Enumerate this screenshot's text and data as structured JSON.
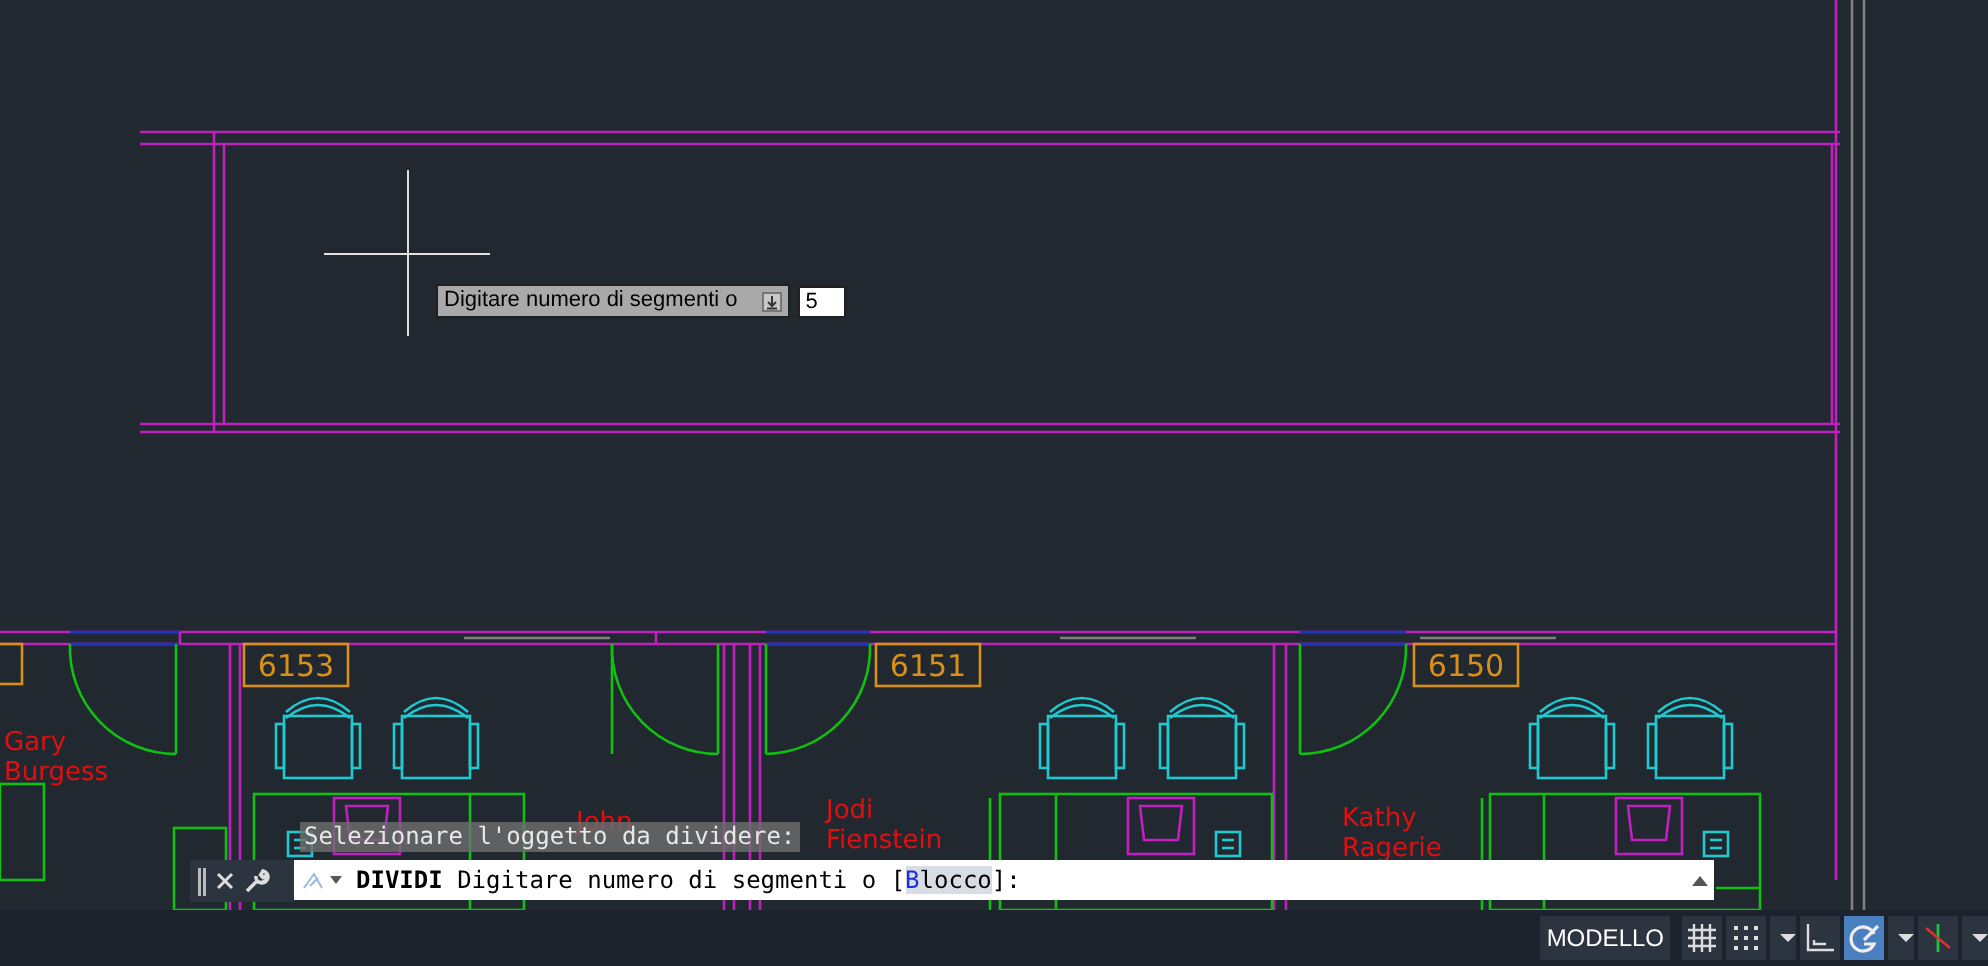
{
  "drawing": {
    "room_tags": [
      {
        "number": "6153"
      },
      {
        "number": "6151"
      },
      {
        "number": "6150"
      }
    ],
    "occupants": [
      {
        "lines": [
          "Gary",
          "Burgess"
        ]
      },
      {
        "lines": [
          "John"
        ]
      },
      {
        "lines": [
          "Jodi",
          "Fienstein"
        ]
      },
      {
        "lines": [
          "Kathy",
          "Ragerie"
        ]
      }
    ]
  },
  "dynamic_input": {
    "prompt": "Digitare numero di segmenti o",
    "value": "5"
  },
  "command_line": {
    "history": "Selezionare l'oggetto da dividere:",
    "command": "DIVIDI",
    "prompt_before": "Digitare numero di segmenti o [",
    "option": {
      "hotkey": "B",
      "rest": "locco"
    },
    "prompt_after": "]:"
  },
  "status_bar": {
    "buttons": [
      {
        "kind": "text",
        "label": "MODELLO",
        "on": false
      },
      {
        "kind": "grid",
        "on": false
      },
      {
        "kind": "snap",
        "on": false
      },
      {
        "kind": "dropdown",
        "on": false
      },
      {
        "kind": "ortho",
        "on": false
      },
      {
        "kind": "polar",
        "on": true
      },
      {
        "kind": "dropdown",
        "on": false
      },
      {
        "kind": "isodraft",
        "on": false
      },
      {
        "kind": "dropdown",
        "on": false
      }
    ]
  }
}
